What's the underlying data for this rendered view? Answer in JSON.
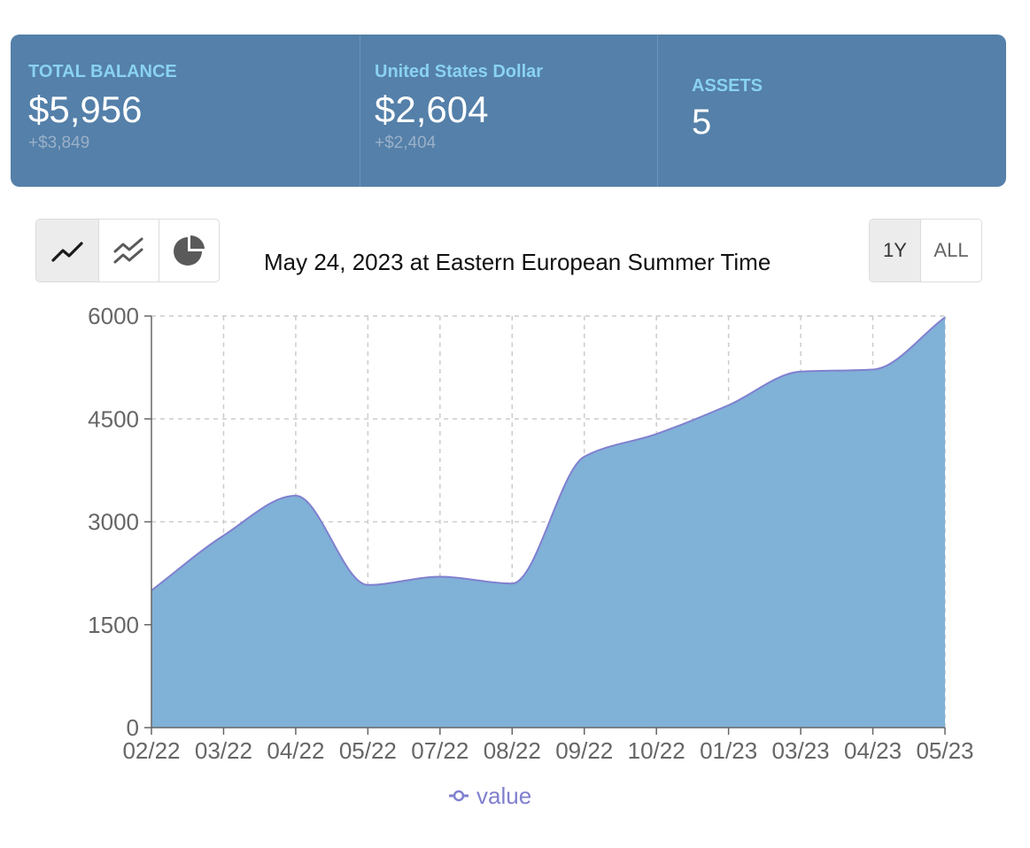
{
  "summary": {
    "total": {
      "label": "TOTAL BALANCE",
      "value": "$5,956",
      "change": "+$3,849"
    },
    "usd": {
      "label": "United States Dollar",
      "value": "$2,604",
      "change": "+$2,404"
    },
    "assets": {
      "label": "ASSETS",
      "value": "5"
    }
  },
  "toolbar": {
    "chart_types": [
      "line-chart-icon",
      "multi-line-chart-icon",
      "pie-chart-icon"
    ],
    "active_chart_type": "line-chart-icon",
    "ranges": [
      {
        "label": "1Y",
        "active": true
      },
      {
        "label": "ALL",
        "active": false
      }
    ]
  },
  "chart_header": {
    "date": "May 24, 2023 at Eastern European Summer Time"
  },
  "colors": {
    "area_fill": "#80b1d7",
    "line": "#8080cf",
    "axis": "#666666",
    "grid": "#cccccc",
    "legend": "#8080cf",
    "panel": "#5480a9",
    "panel_label": "#8ad2f0"
  },
  "chart_data": {
    "type": "area",
    "categories": [
      "02/22",
      "03/22",
      "04/22",
      "05/22",
      "07/22",
      "08/22",
      "09/22",
      "10/22",
      "01/23",
      "03/23",
      "04/23",
      "05/23"
    ],
    "series": [
      {
        "name": "value",
        "values": [
          2000,
          2800,
          3380,
          2080,
          2200,
          2100,
          3950,
          4280,
          4700,
          5190,
          5220,
          5980
        ]
      }
    ],
    "yticks": [
      0,
      1500,
      3000,
      4500,
      6000
    ],
    "ylim": [
      0,
      6000
    ],
    "grid": true,
    "legend": "bottom-center"
  }
}
